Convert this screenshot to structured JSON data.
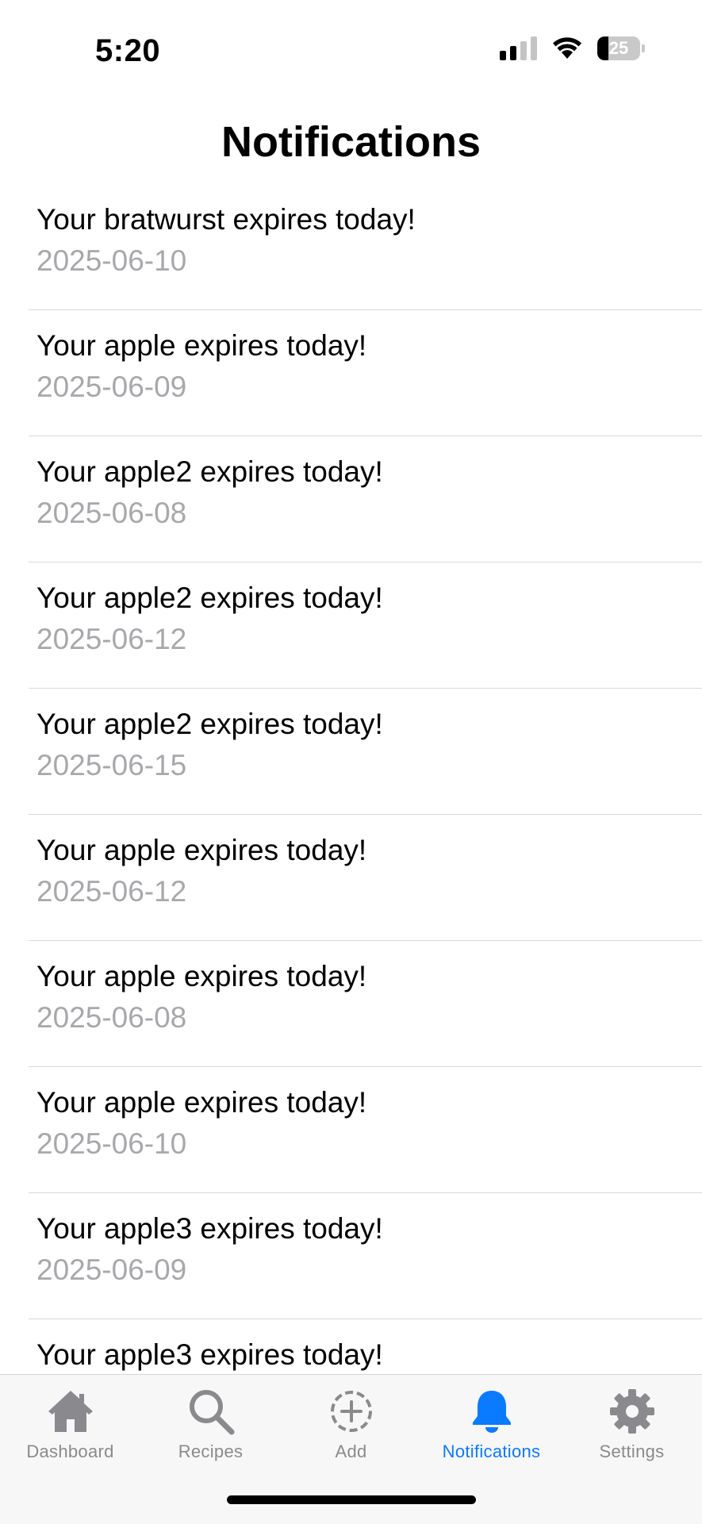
{
  "status_bar": {
    "time": "5:20",
    "battery": "25",
    "signal_bars_active": 2,
    "signal_bars_total": 4
  },
  "header": {
    "title": "Notifications"
  },
  "notifications": [
    {
      "message": "Your bratwurst expires today!",
      "date": "2025-06-10"
    },
    {
      "message": "Your apple expires today!",
      "date": "2025-06-09"
    },
    {
      "message": "Your apple2 expires today!",
      "date": "2025-06-08"
    },
    {
      "message": "Your apple2 expires today!",
      "date": "2025-06-12"
    },
    {
      "message": "Your apple2 expires today!",
      "date": "2025-06-15"
    },
    {
      "message": "Your apple expires today!",
      "date": "2025-06-12"
    },
    {
      "message": "Your apple expires today!",
      "date": "2025-06-08"
    },
    {
      "message": "Your apple expires today!",
      "date": "2025-06-10"
    },
    {
      "message": "Your apple3 expires today!",
      "date": "2025-06-09"
    },
    {
      "message": "Your apple3 expires today!",
      "date": ""
    }
  ],
  "tab_bar": {
    "tabs": [
      {
        "label": "Dashboard",
        "icon": "house-icon"
      },
      {
        "label": "Recipes",
        "icon": "magnifying-glass-icon"
      },
      {
        "label": "Add",
        "icon": "plus-circle-dashed-icon"
      },
      {
        "label": "Notifications",
        "icon": "bell-icon",
        "active": true
      },
      {
        "label": "Settings",
        "icon": "gear-icon"
      }
    ]
  },
  "colors": {
    "accent": "#0a7aff",
    "secondary_text": "#a8a8ac",
    "tab_inactive": "#8a8a8e",
    "separator": "#d9d9dc"
  }
}
